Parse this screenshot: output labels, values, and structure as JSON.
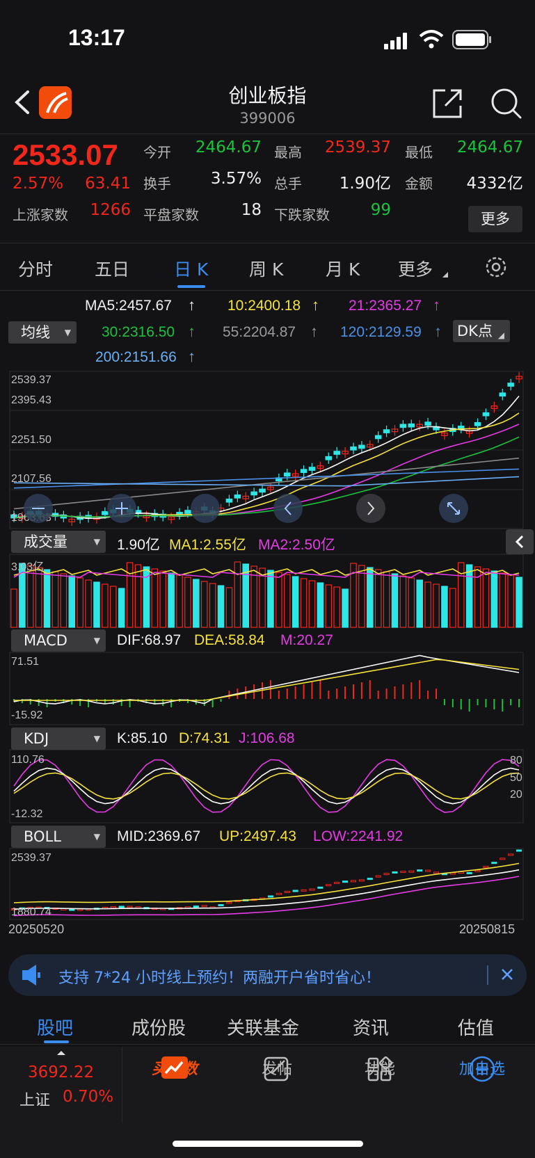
{
  "status": {
    "time": "13:17"
  },
  "header": {
    "title": "创业板指",
    "code": "399006"
  },
  "quote": {
    "price": "2533.07",
    "change_pct": "2.57%",
    "change": "63.41",
    "up_count_label": "上涨家数",
    "up_count": "1266",
    "flat_count_label": "平盘家数",
    "flat_count": "18",
    "down_count_label": "下跌家数",
    "down_count": "99",
    "open_label": "今开",
    "open": "2464.67",
    "high_label": "最高",
    "high": "2539.37",
    "low_label": "最低",
    "low": "2464.67",
    "turnover_label": "换手",
    "turnover": "3.57%",
    "volume_label": "总手",
    "volume": "1.90亿",
    "amount_label": "金额",
    "amount": "4332亿",
    "more_label": "更多"
  },
  "tabs": [
    {
      "label": "分时"
    },
    {
      "label": "五日"
    },
    {
      "label": "日 K"
    },
    {
      "label": "周 K"
    },
    {
      "label": "月 K"
    },
    {
      "label": "更多"
    }
  ],
  "ma": {
    "selector": "均线",
    "ma5": "MA5:2457.67",
    "ma10": "10:2400.18",
    "ma21": "21:2365.27",
    "ma30": "30:2316.50",
    "ma55": "55:2204.87",
    "ma120": "120:2129.59",
    "ma200": "200:2151.66",
    "dk_label": "DK点"
  },
  "kline_axis": {
    "t1": "2539.37",
    "t2": "2395.43",
    "t3": "2251.50",
    "t4": "2107.56",
    "t5": "1963.63"
  },
  "volume": {
    "selector": "成交量",
    "value": "1.90亿",
    "ma1": "MA1:2.55亿",
    "ma2": "MA2:2.50亿",
    "axis_top": "3.03亿"
  },
  "macd": {
    "selector": "MACD",
    "dif": "DIF:68.97",
    "dea": "DEA:58.84",
    "m": "M:20.27",
    "axis_top": "71.51",
    "axis_bottom": "-15.92"
  },
  "kdj": {
    "selector": "KDJ",
    "k": "K:85.10",
    "d": "D:74.31",
    "j": "J:106.68",
    "axis_top": "110.76",
    "axis_bottom": "-12.32",
    "r80": "80",
    "r50": "50",
    "r20": "20"
  },
  "boll": {
    "selector": "BOLL",
    "mid": "MID:2369.67",
    "up": "UP:2497.43",
    "low": "LOW:2241.92",
    "axis_top": "2539.37",
    "axis_bottom": "1880.74"
  },
  "dates": {
    "start": "20250520",
    "end": "20250815"
  },
  "banner": {
    "text": "支持 7*24 小时线上预约！两融开户省时省心！"
  },
  "bottom_tabs": [
    {
      "label": "股吧"
    },
    {
      "label": "成份股"
    },
    {
      "label": "关联基金"
    },
    {
      "label": "资讯"
    },
    {
      "label": "估值"
    }
  ],
  "bottom_nav": {
    "sh_value": "3692.22",
    "sh_label": "上证",
    "sh_change": "0.70%",
    "buy_label": "买指数",
    "post_label": "发帖",
    "func_label": "功能",
    "watch_label": "加自选"
  },
  "colors": {
    "up": "#f2271c",
    "down": "#19c33b",
    "accent": "#3a8cf0",
    "cyan": "#2ee6e6"
  }
}
